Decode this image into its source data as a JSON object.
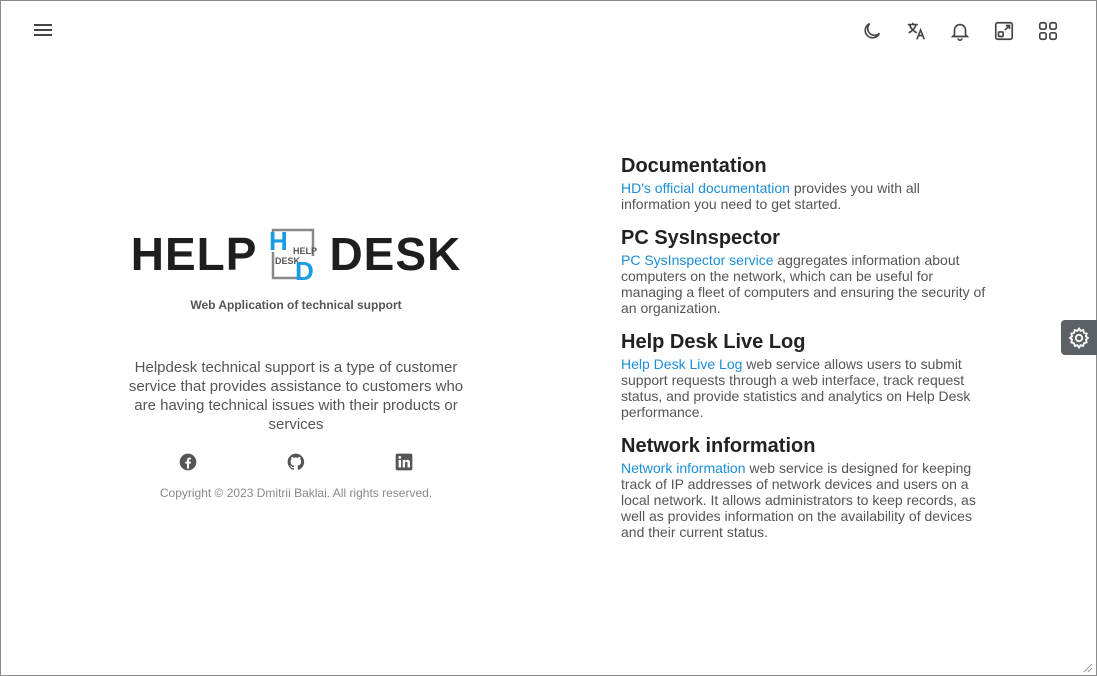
{
  "header": {
    "menu_icon": "menu-icon",
    "icons": [
      "moon-icon",
      "translate-icon",
      "bell-icon",
      "fullscreen-icon",
      "apps-grid-icon"
    ]
  },
  "logo": {
    "left": "HELP",
    "right": "DESK",
    "badge_small_top": "HELP",
    "badge_small_bottom": "DESK",
    "badge_h": "H",
    "badge_d": "D"
  },
  "tagline": "Web Application of technical support",
  "description": "Helpdesk technical support is a type of customer service that provides assistance to customers who are having technical issues with their products or services",
  "socials": [
    "facebook-icon",
    "github-icon",
    "linkedin-icon"
  ],
  "copyright": "Copyright © 2023 Dmitrii Baklai. All rights reserved.",
  "sections": [
    {
      "title": "Documentation",
      "link": "HD's official documentation",
      "text": " provides you with all information you need to get started."
    },
    {
      "title": "PC SysInspector",
      "link": "PC SysInspector service",
      "text": " aggregates information about computers on the network, which can be useful for managing a fleet of computers and ensuring the security of an organization."
    },
    {
      "title": "Help Desk Live Log",
      "link": "Help Desk Live Log",
      "text": " web service allows users to submit support requests through a web interface, track request status, and provide statistics and analytics on Help Desk performance."
    },
    {
      "title": "Network information",
      "link": "Network information",
      "text": " web service is designed for keeping track of IP addresses of network devices and users on a local network. It allows administrators to keep records, as well as provides information on the availability of devices and their current status."
    }
  ],
  "colors": {
    "accent": "#1a8ed8",
    "logo_blue": "#1a9be6",
    "settings_bg": "#5c6166"
  }
}
